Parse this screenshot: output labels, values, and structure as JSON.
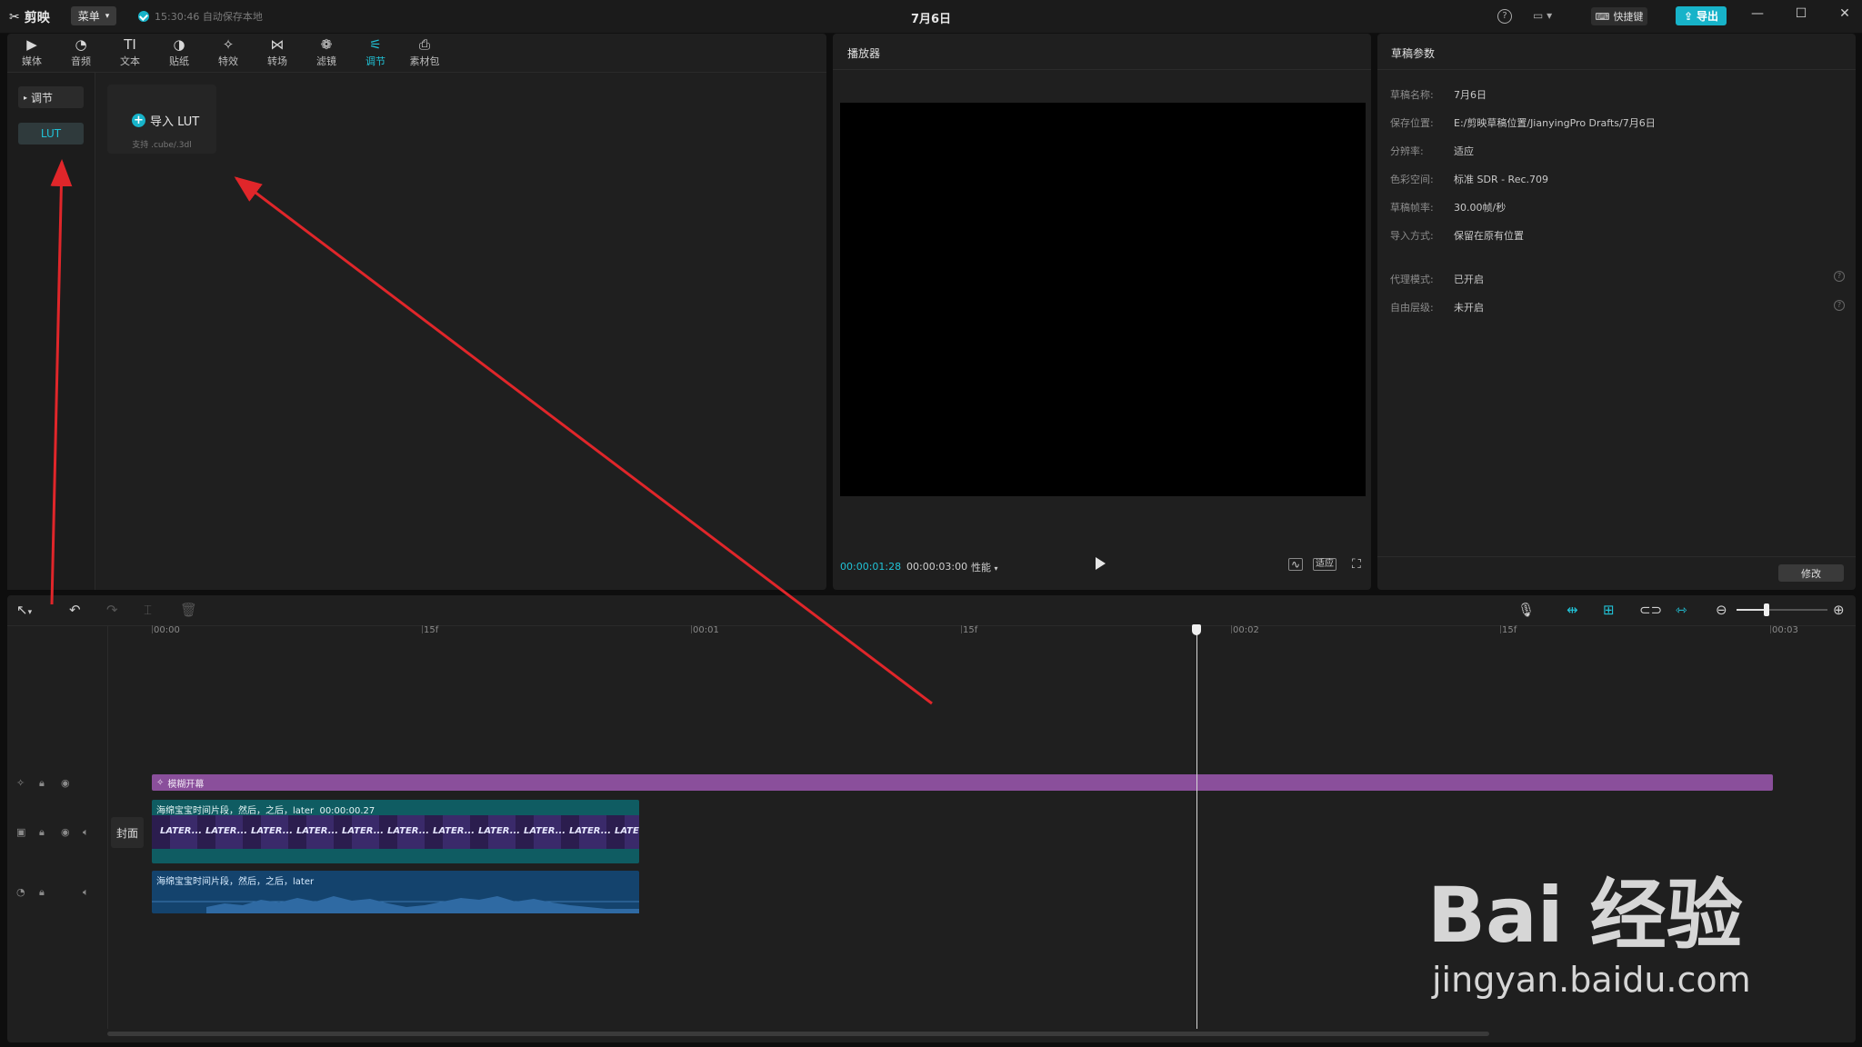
{
  "app": {
    "name": "剪映",
    "menu_label": "菜单",
    "save_status": "15:30:46 自动保存本地",
    "window_title": "7月6日",
    "shortcut_label": "快捷键",
    "export_label": "导出"
  },
  "tabs": [
    {
      "label": "媒体",
      "icon": "media-icon"
    },
    {
      "label": "音频",
      "icon": "audio-icon"
    },
    {
      "label": "文本",
      "icon": "text-icon"
    },
    {
      "label": "贴纸",
      "icon": "sticker-icon"
    },
    {
      "label": "特效",
      "icon": "effects-icon"
    },
    {
      "label": "转场",
      "icon": "transition-icon"
    },
    {
      "label": "滤镜",
      "icon": "filter-icon"
    },
    {
      "label": "调节",
      "icon": "adjust-icon",
      "active": true
    },
    {
      "label": "素材包",
      "icon": "asset-pack-icon"
    }
  ],
  "sidebar": {
    "adjust_label": "调节",
    "lut_label": "LUT"
  },
  "import_lut": {
    "label": "导入 LUT",
    "sub": "支持 .cube/.3dl"
  },
  "player": {
    "title": "播放器",
    "current_time": "00:00:01:28",
    "total_time": "00:00:03:00",
    "perf_label": "性能",
    "ratio_label": "适应"
  },
  "draft": {
    "title": "草稿参数",
    "params": [
      {
        "k": "草稿名称:",
        "v": "7月6日"
      },
      {
        "k": "保存位置:",
        "v": "E:/剪映草稿位置/JianyingPro Drafts/7月6日"
      },
      {
        "k": "分辨率:",
        "v": "适应"
      },
      {
        "k": "色彩空间:",
        "v": "标准 SDR - Rec.709"
      },
      {
        "k": "草稿帧率:",
        "v": "30.00帧/秒"
      },
      {
        "k": "导入方式:",
        "v": "保留在原有位置"
      },
      {
        "k": "代理模式:",
        "v": "已开启"
      },
      {
        "k": "自由层级:",
        "v": "未开启"
      }
    ],
    "modify_label": "修改"
  },
  "timeline": {
    "ruler": [
      "00:00",
      "15f",
      "00:01",
      "15f",
      "00:02",
      "15f",
      "00:03"
    ],
    "effect_clip_label": "模糊开幕",
    "video_clip_label": "海绵宝宝时间片段，然后，之后，later",
    "video_clip_duration": "00:00:00.27",
    "video_frame_text": "LATER...",
    "audio_clip_label": "海绵宝宝时间片段，然后，之后，later",
    "cover_label": "封面"
  },
  "watermark": {
    "line1": "Bai  经验",
    "line2": "jingyan.baidu.com"
  },
  "colors": {
    "accent": "#17b3c9",
    "effect_clip": "#8a4f9b",
    "video_clip": "#0f5c62",
    "audio_clip": "#14436d",
    "annotation_arrow": "#e0262a"
  }
}
